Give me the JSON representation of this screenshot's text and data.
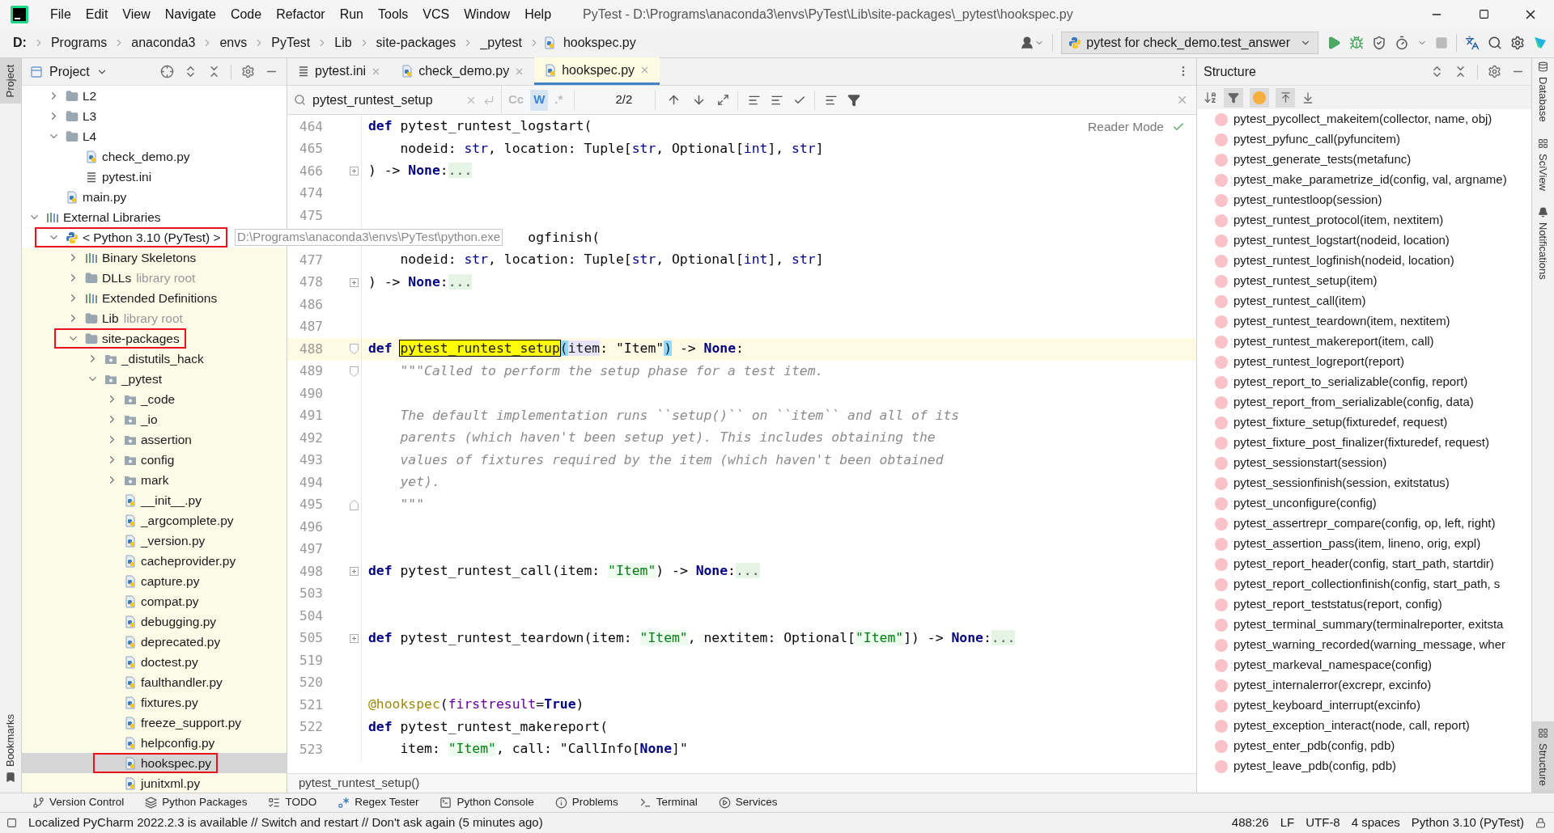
{
  "window": {
    "title": "PyTest - D:\\Programs\\anaconda3\\envs\\PyTest\\Lib\\site-packages\\_pytest\\hookspec.py"
  },
  "menu": [
    "File",
    "Edit",
    "View",
    "Navigate",
    "Code",
    "Refactor",
    "Run",
    "Tools",
    "VCS",
    "Window",
    "Help"
  ],
  "breadcrumbs": [
    "D:",
    "Programs",
    "anaconda3",
    "envs",
    "PyTest",
    "Lib",
    "site-packages",
    "_pytest",
    "hookspec.py"
  ],
  "run_config": "pytest for check_demo.test_answer",
  "left_strip": [
    "Project",
    "Bookmarks"
  ],
  "right_strip": [
    "Database",
    "SciView",
    "Notifications",
    "Structure"
  ],
  "project": {
    "title": "Project",
    "root_children": [
      {
        "label": "L2",
        "kind": "folder",
        "expanded": false
      },
      {
        "label": "L3",
        "kind": "folder",
        "expanded": false
      },
      {
        "label": "L4",
        "kind": "folder",
        "expanded": true,
        "children": [
          {
            "label": "check_demo.py",
            "kind": "py"
          },
          {
            "label": "pytest.ini",
            "kind": "ini"
          }
        ]
      },
      {
        "label": "main.py",
        "kind": "py"
      }
    ],
    "items": [
      {
        "label": "External Libraries",
        "kind": "lib",
        "expanded": true,
        "children": [
          {
            "label": "< Python 3.10 (PyTest) >",
            "kind": "python",
            "expanded": true,
            "outlined": true,
            "library": true,
            "children": [
              {
                "label": "Binary Skeletons",
                "kind": "lib",
                "expanded": false
              },
              {
                "label": "DLLs",
                "suffix": "library root",
                "kind": "folder",
                "expanded": false
              },
              {
                "label": "Extended Definitions",
                "kind": "lib",
                "expanded": false
              },
              {
                "label": "Lib",
                "suffix": "library root",
                "kind": "folder",
                "expanded": false
              },
              {
                "label": "site-packages",
                "kind": "folder",
                "expanded": true,
                "outlined": true,
                "children": [
                  {
                    "label": "_distutils_hack",
                    "kind": "pkg",
                    "expanded": false
                  },
                  {
                    "label": "_pytest",
                    "kind": "pkg",
                    "expanded": true,
                    "children": [
                      {
                        "label": "_code",
                        "kind": "pkg",
                        "expanded": false
                      },
                      {
                        "label": "_io",
                        "kind": "pkg",
                        "expanded": false
                      },
                      {
                        "label": "assertion",
                        "kind": "pkg",
                        "expanded": false
                      },
                      {
                        "label": "config",
                        "kind": "pkg",
                        "expanded": false
                      },
                      {
                        "label": "mark",
                        "kind": "pkg",
                        "expanded": false
                      },
                      {
                        "label": "__init__.py",
                        "kind": "py"
                      },
                      {
                        "label": "_argcomplete.py",
                        "kind": "py"
                      },
                      {
                        "label": "_version.py",
                        "kind": "py"
                      },
                      {
                        "label": "cacheprovider.py",
                        "kind": "py"
                      },
                      {
                        "label": "capture.py",
                        "kind": "py"
                      },
                      {
                        "label": "compat.py",
                        "kind": "py"
                      },
                      {
                        "label": "debugging.py",
                        "kind": "py"
                      },
                      {
                        "label": "deprecated.py",
                        "kind": "py"
                      },
                      {
                        "label": "doctest.py",
                        "kind": "py"
                      },
                      {
                        "label": "faulthandler.py",
                        "kind": "py"
                      },
                      {
                        "label": "fixtures.py",
                        "kind": "py"
                      },
                      {
                        "label": "freeze_support.py",
                        "kind": "py"
                      },
                      {
                        "label": "helpconfig.py",
                        "kind": "py"
                      },
                      {
                        "label": "hookspec.py",
                        "kind": "py",
                        "selected": true,
                        "outlined": true
                      },
                      {
                        "label": "junitxml.py",
                        "kind": "py"
                      }
                    ]
                  }
                ]
              }
            ]
          }
        ]
      }
    ]
  },
  "path_tooltip": "D:\\Programs\\anaconda3\\envs\\PyTest\\python.exe",
  "tabs": [
    {
      "label": "pytest.ini",
      "kind": "ini",
      "selected": false
    },
    {
      "label": "check_demo.py",
      "kind": "py",
      "selected": false
    },
    {
      "label": "hookspec.py",
      "kind": "py",
      "selected": true
    }
  ],
  "find": {
    "value": "pytest_runtest_setup",
    "toggles": [
      {
        "label": "Cc",
        "on": false
      },
      {
        "label": "W",
        "on": true
      },
      {
        "label": ".*",
        "on": false
      }
    ],
    "count": "2/2"
  },
  "reader_mode": "Reader Mode",
  "code": [
    {
      "n": "464",
      "t": [
        {
          "kind": "kw",
          "text": "def "
        },
        {
          "kind": "plain",
          "text": "pytest_runtest_logstart("
        }
      ]
    },
    {
      "n": "465",
      "t": [
        {
          "kind": "plain",
          "text": "    nodeid: "
        },
        {
          "kind": "bi",
          "text": "str"
        },
        {
          "kind": "plain",
          "text": ", location: Tuple["
        },
        {
          "kind": "bi",
          "text": "str"
        },
        {
          "kind": "plain",
          "text": ", Optional["
        },
        {
          "kind": "bi",
          "text": "int"
        },
        {
          "kind": "plain",
          "text": "], "
        },
        {
          "kind": "bi",
          "text": "str"
        },
        {
          "kind": "plain",
          "text": "]"
        }
      ]
    },
    {
      "n": "466",
      "fold": {
        "kind": "collapsed"
      },
      "t": [
        {
          "kind": "plain",
          "text": ") -> "
        },
        {
          "kind": "const",
          "text": "None"
        },
        {
          "kind": "plain",
          "text": ":"
        },
        {
          "kind": "fold",
          "text": "..."
        }
      ]
    },
    {
      "n": "474"
    },
    {
      "n": "475"
    },
    {
      "covered": true,
      "t": [
        {
          "kind": "plain",
          "text": "ogfinish("
        }
      ]
    },
    {
      "n": "477",
      "t": [
        {
          "kind": "plain",
          "text": "    nodeid: "
        },
        {
          "kind": "bi",
          "text": "str"
        },
        {
          "kind": "plain",
          "text": ", location: Tuple["
        },
        {
          "kind": "bi",
          "text": "str"
        },
        {
          "kind": "plain",
          "text": ", Optional["
        },
        {
          "kind": "bi",
          "text": "int"
        },
        {
          "kind": "plain",
          "text": "], "
        },
        {
          "kind": "bi",
          "text": "str"
        },
        {
          "kind": "plain",
          "text": "]"
        }
      ]
    },
    {
      "n": "478",
      "fold": {
        "kind": "collapsed"
      },
      "t": [
        {
          "kind": "plain",
          "text": ") -> "
        },
        {
          "kind": "const",
          "text": "None"
        },
        {
          "kind": "plain",
          "text": ":"
        },
        {
          "kind": "fold",
          "text": "..."
        }
      ]
    },
    {
      "n": "486"
    },
    {
      "n": "487"
    },
    {
      "n": "488",
      "current": true,
      "fold": {
        "kind": "open"
      },
      "t": [
        {
          "kind": "kw",
          "text": "def "
        },
        {
          "kind": "match",
          "text": "pytest_runtest_setup"
        },
        {
          "kind": "brace",
          "text": "("
        },
        {
          "kind": "param",
          "text": "item"
        },
        {
          "kind": "plain",
          "text": ": \"Item\""
        },
        {
          "kind": "brace",
          "text": ")"
        },
        {
          "kind": "plain",
          "text": " -> "
        },
        {
          "kind": "const",
          "text": "None"
        },
        {
          "kind": "plain",
          "text": ":"
        }
      ]
    },
    {
      "n": "489",
      "fold": {
        "kind": "open"
      },
      "t": [
        {
          "kind": "doc",
          "text": "    \"\"\"Called to perform the setup phase for a test item."
        }
      ]
    },
    {
      "n": "490"
    },
    {
      "n": "491",
      "t": [
        {
          "kind": "doc",
          "text": "    The default implementation runs ``setup()`` on ``item`` and all of its"
        }
      ]
    },
    {
      "n": "492",
      "t": [
        {
          "kind": "doc",
          "text": "    parents (which haven't been setup yet). This includes obtaining the"
        }
      ]
    },
    {
      "n": "493",
      "t": [
        {
          "kind": "doc",
          "text": "    values of fixtures required by the item (which haven't been obtained"
        }
      ]
    },
    {
      "n": "494",
      "t": [
        {
          "kind": "doc",
          "text": "    yet)."
        }
      ]
    },
    {
      "n": "495",
      "fold": {
        "kind": "end"
      },
      "t": [
        {
          "kind": "doc",
          "text": "    \"\"\""
        }
      ]
    },
    {
      "n": "496"
    },
    {
      "n": "497"
    },
    {
      "n": "498",
      "fold": {
        "kind": "collapsed"
      },
      "t": [
        {
          "kind": "kw",
          "text": "def "
        },
        {
          "kind": "plain",
          "text": "pytest_runtest_call(item: "
        },
        {
          "kind": "str",
          "text": "\"Item\""
        },
        {
          "kind": "plain",
          "text": ") -> "
        },
        {
          "kind": "const",
          "text": "None"
        },
        {
          "kind": "plain",
          "text": ":"
        },
        {
          "kind": "fold",
          "text": "..."
        }
      ]
    },
    {
      "n": "503"
    },
    {
      "n": "504"
    },
    {
      "n": "505",
      "fold": {
        "kind": "collapsed"
      },
      "t": [
        {
          "kind": "kw",
          "text": "def "
        },
        {
          "kind": "plain",
          "text": "pytest_runtest_teardown(item: "
        },
        {
          "kind": "str",
          "text": "\"Item\""
        },
        {
          "kind": "plain",
          "text": ", nextitem: Optional["
        },
        {
          "kind": "str",
          "text": "\"Item\""
        },
        {
          "kind": "plain",
          "text": "]) -> "
        },
        {
          "kind": "const",
          "text": "None"
        },
        {
          "kind": "plain",
          "text": ":"
        },
        {
          "kind": "fold",
          "text": "..."
        }
      ]
    },
    {
      "n": "519"
    },
    {
      "n": "520"
    },
    {
      "n": "521",
      "t": [
        {
          "kind": "deco",
          "text": "@hookspec"
        },
        {
          "kind": "plain",
          "text": "("
        },
        {
          "kind": "named",
          "text": "firstresult"
        },
        {
          "kind": "plain",
          "text": "="
        },
        {
          "kind": "const",
          "text": "True"
        },
        {
          "kind": "plain",
          "text": ")"
        }
      ]
    },
    {
      "n": "522",
      "t": [
        {
          "kind": "kw",
          "text": "def "
        },
        {
          "kind": "plain",
          "text": "pytest_runtest_makereport("
        }
      ]
    },
    {
      "n": "523",
      "t": [
        {
          "kind": "plain",
          "text": "    item: "
        },
        {
          "kind": "str",
          "text": "\"Item\""
        },
        {
          "kind": "plain",
          "text": ", call: \"CallInfo["
        },
        {
          "kind": "const",
          "text": "None"
        },
        {
          "kind": "plain",
          "text": "]\""
        }
      ]
    }
  ],
  "editor_breadcrumb": "pytest_runtest_setup()",
  "structure": {
    "title": "Structure",
    "items": [
      "pytest_pycollect_makeitem(collector, name, obj)",
      "pytest_pyfunc_call(pyfuncitem)",
      "pytest_generate_tests(metafunc)",
      "pytest_make_parametrize_id(config, val, argname)",
      "pytest_runtestloop(session)",
      "pytest_runtest_protocol(item, nextitem)",
      "pytest_runtest_logstart(nodeid, location)",
      "pytest_runtest_logfinish(nodeid, location)",
      "pytest_runtest_setup(item)",
      "pytest_runtest_call(item)",
      "pytest_runtest_teardown(item, nextitem)",
      "pytest_runtest_makereport(item, call)",
      "pytest_runtest_logreport(report)",
      "pytest_report_to_serializable(config, report)",
      "pytest_report_from_serializable(config, data)",
      "pytest_fixture_setup(fixturedef, request)",
      "pytest_fixture_post_finalizer(fixturedef, request)",
      "pytest_sessionstart(session)",
      "pytest_sessionfinish(session, exitstatus)",
      "pytest_unconfigure(config)",
      "pytest_assertrepr_compare(config, op, left, right)",
      "pytest_assertion_pass(item, lineno, orig, expl)",
      "pytest_report_header(config, start_path, startdir)",
      "pytest_report_collectionfinish(config, start_path, s",
      "pytest_report_teststatus(report, config)",
      "pytest_terminal_summary(terminalreporter, exitsta",
      "pytest_warning_recorded(warning_message, wher",
      "pytest_markeval_namespace(config)",
      "pytest_internalerror(excrepr, excinfo)",
      "pytest_keyboard_interrupt(excinfo)",
      "pytest_exception_interact(node, call, report)",
      "pytest_enter_pdb(config, pdb)",
      "pytest_leave_pdb(config, pdb)"
    ]
  },
  "tool_windows": [
    {
      "label": "Version Control",
      "kind": "vcs"
    },
    {
      "label": "Python Packages",
      "kind": "packages"
    },
    {
      "label": "TODO",
      "kind": "todo"
    },
    {
      "label": "Regex Tester",
      "kind": "regex"
    },
    {
      "label": "Python Console",
      "kind": "console"
    },
    {
      "label": "Problems",
      "kind": "problems"
    },
    {
      "label": "Terminal",
      "kind": "terminal"
    },
    {
      "label": "Services",
      "kind": "services"
    }
  ],
  "status": {
    "message": "Localized PyCharm 2022.2.3 is available // Switch and restart // Don't ask again (5 minutes ago)",
    "items": [
      "488:26",
      "LF",
      "UTF-8",
      "4 spaces",
      "Python 3.10 (PyTest)"
    ]
  }
}
